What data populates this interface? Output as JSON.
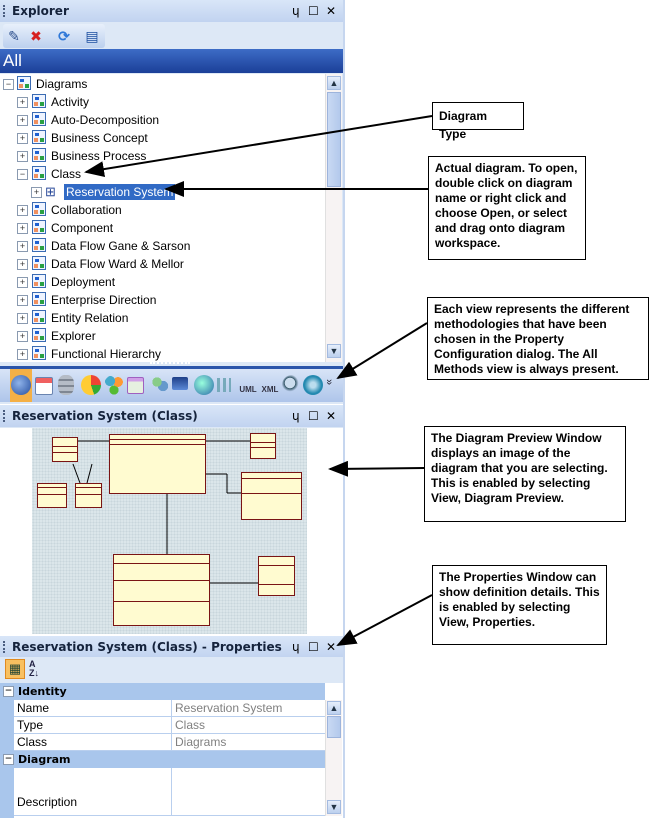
{
  "explorer": {
    "title": "Explorer",
    "controls": {
      "pin": "ᵖ",
      "maximize": "☐",
      "close": "✕"
    },
    "toolbar": [
      {
        "name": "edit-icon",
        "glyph": "✎"
      },
      {
        "name": "delete-icon",
        "glyph": "✖"
      },
      {
        "name": "refresh-icon",
        "glyph": "⟳"
      },
      {
        "name": "properties-icon",
        "glyph": "▤"
      }
    ],
    "view_label": "All",
    "tree": {
      "root": "Diagrams",
      "items": [
        "Activity",
        "Auto-Decomposition",
        "Business Concept",
        "Business Process",
        "Class",
        "Collaboration",
        "Component",
        "Data Flow Gane & Sarson",
        "Data Flow Ward & Mellor",
        "Deployment",
        "Enterprise Direction",
        "Entity Relation",
        "Explorer",
        "Functional Hierarchy"
      ],
      "expanded_item": "Class",
      "child": "Reservation System"
    },
    "method_icons": [
      "all-methods-icon",
      "org-icon",
      "database-icon",
      "chart-icon",
      "network-icon",
      "windows-icon",
      "users-icon",
      "monitor-icon",
      "globe-icon",
      "transform-icon",
      "uml-search-icon",
      "xml-search-icon",
      "web-search-icon",
      "scales-icon"
    ],
    "method_icon_labels": {
      "uml": "UML",
      "xml": "XML"
    },
    "more": "»"
  },
  "preview": {
    "title": "Reservation System (Class)"
  },
  "properties": {
    "title": "Reservation System (Class) - Properties",
    "toolbar": {
      "categorized": "▦",
      "alphabetical": "A↓Z"
    },
    "categories": [
      {
        "name": "Identity",
        "rows": [
          {
            "key": "Name",
            "value": "Reservation System"
          },
          {
            "key": "Type",
            "value": "Class"
          },
          {
            "key": "Class",
            "value": "Diagrams"
          }
        ]
      },
      {
        "name": "Diagram",
        "rows": [
          {
            "key": "Description",
            "value": ""
          }
        ]
      }
    ]
  },
  "callouts": {
    "diagram_type": "Diagram Type",
    "actual_diagram": "Actual diagram.  To open, double click on diagram name or right click and choose Open, or select and drag onto diagram workspace.",
    "views": "Each view represents the different methodologies that have been chosen in the Property Configuration dialog.  The All Methods view is always present.",
    "preview_window": "The Diagram Preview Window displays an image of the diagram that you are selecting.  This is enabled by selecting View, Diagram Preview.",
    "properties_window": "The Properties Window can show definition details.  This is enabled by selecting View, Properties."
  }
}
